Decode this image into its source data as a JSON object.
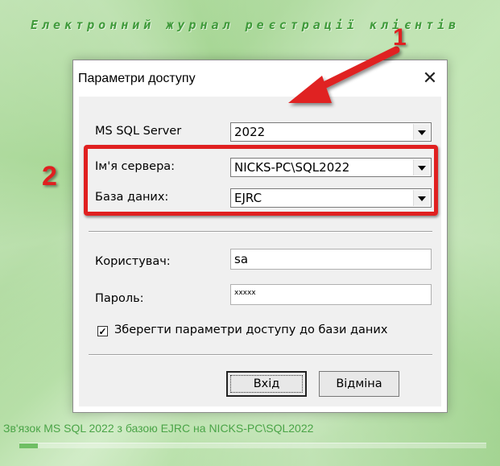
{
  "app": {
    "title": "Електронний журнал реєстрації клієнтів",
    "status": "Зв'язок MS SQL 2022 з базою EJRC на NICKS-PC\\SQL2022",
    "status_progress": 0.01
  },
  "dialog": {
    "title": "Параметри доступу",
    "close_glyph": "✕",
    "fields": {
      "sql_version": {
        "label": "MS SQL Server",
        "value": "2022"
      },
      "server_name": {
        "label": "Ім'я сервера:",
        "value": "NICKS-PC\\SQL2022"
      },
      "database": {
        "label": "База даних:",
        "value": "EJRC"
      },
      "user": {
        "label": "Користувач:",
        "value": "sa"
      },
      "password": {
        "label": "Пароль:",
        "value": "xxxxx"
      }
    },
    "save_checkbox": {
      "label": "Зберегти параметри доступу до бази даних",
      "checked": true,
      "mark": "✓"
    },
    "buttons": {
      "login": "Вхід",
      "cancel": "Відміна"
    }
  },
  "annotations": {
    "one": "1",
    "two": "2"
  },
  "colors": {
    "accent_red": "#e02020",
    "title_green": "#3f9a3a",
    "status_green": "#4aa447",
    "background_green": "#a6d694"
  }
}
